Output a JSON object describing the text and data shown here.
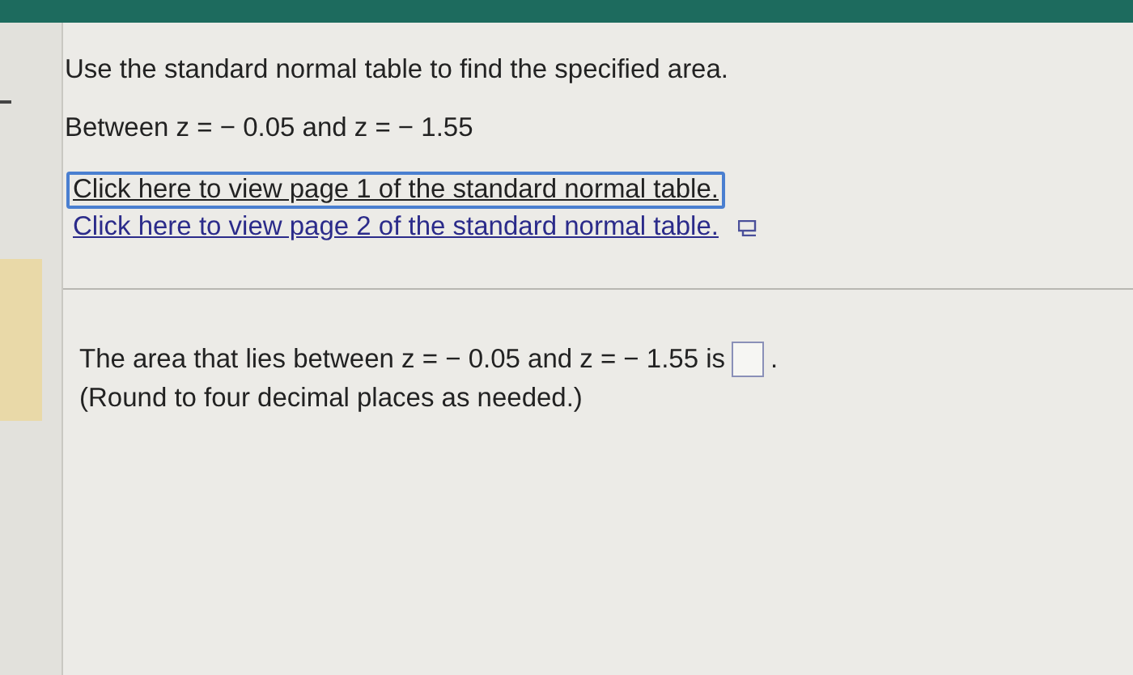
{
  "question": {
    "instruction": "Use the standard normal table to find the specified area.",
    "given": "Between z = − 0.05 and z = − 1.55",
    "links": [
      {
        "label": "Click here to view page 1 of the standard normal table.",
        "focused": true
      },
      {
        "label": "Click here to view page 2 of the standard normal table.",
        "focused": false
      }
    ]
  },
  "answer": {
    "prompt": "The area that lies between z = − 0.05 and z = − 1.55 is",
    "period": ".",
    "hint": "(Round to four decimal places as needed.)"
  }
}
